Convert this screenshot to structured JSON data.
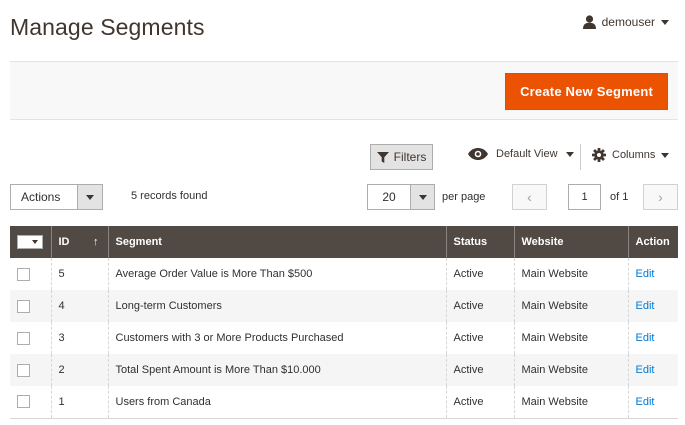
{
  "header": {
    "title": "Manage Segments",
    "user": "demouser"
  },
  "actions": {
    "create_label": "Create New Segment"
  },
  "toolbar": {
    "filters_label": "Filters",
    "view_label": "Default View",
    "columns_label": "Columns",
    "mass_action_label": "Actions",
    "records_found": "5 records found",
    "per_page_value": "20",
    "per_page_label": "per page",
    "page_value": "1",
    "page_of": "of 1",
    "prev_glyph": "‹",
    "next_glyph": "›"
  },
  "table": {
    "columns": [
      "ID",
      "Segment",
      "Status",
      "Website",
      "Action"
    ],
    "sort_indicator": "↑",
    "rows": [
      {
        "id": "5",
        "segment": "Average Order Value is More Than $500",
        "status": "Active",
        "website": "Main Website",
        "action": "Edit"
      },
      {
        "id": "4",
        "segment": "Long-term Customers",
        "status": "Active",
        "website": "Main Website",
        "action": "Edit"
      },
      {
        "id": "3",
        "segment": "Customers with 3 or More Products Purchased",
        "status": "Active",
        "website": "Main Website",
        "action": "Edit"
      },
      {
        "id": "2",
        "segment": "Total Spent Amount is More Than $10.000",
        "status": "Active",
        "website": "Main Website",
        "action": "Edit"
      },
      {
        "id": "1",
        "segment": "Users from Canada",
        "status": "Active",
        "website": "Main Website",
        "action": "Edit"
      }
    ]
  },
  "colors": {
    "accent": "#eb5202",
    "header_bg": "#514943",
    "link": "#007bdb"
  },
  "icons": [
    "user-icon",
    "filter-icon",
    "eye-icon",
    "gear-icon",
    "chevron-down-icon"
  ]
}
